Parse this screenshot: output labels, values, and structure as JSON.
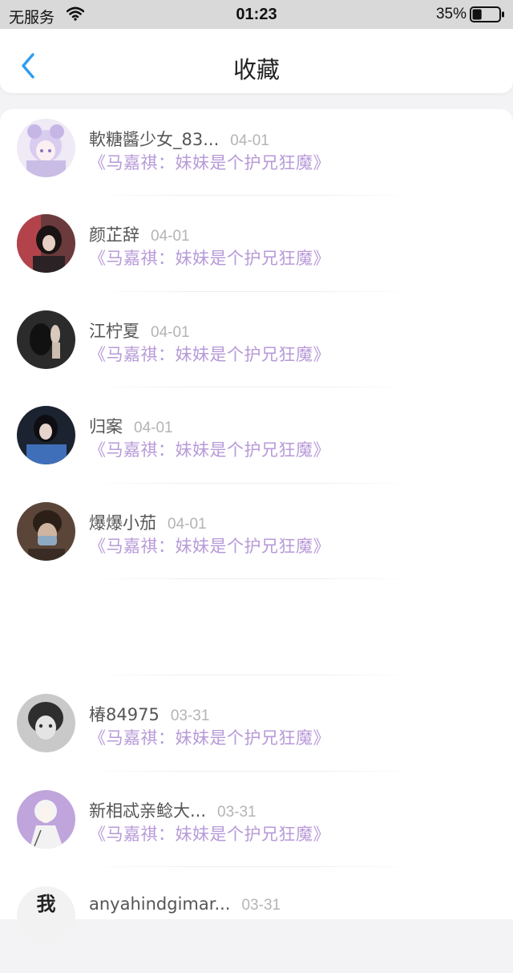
{
  "status_bar": {
    "carrier": "无服务",
    "time": "01:23",
    "battery_percent": "35%",
    "battery_level": 0.35
  },
  "header": {
    "back_icon": "chevron-left-icon",
    "title": "收藏"
  },
  "favorites": [
    {
      "name": "軟糖醬少女_83...",
      "date": "04-01",
      "title": "《马嘉祺：妹妹是个护兄狂魔》"
    },
    {
      "name": "颜芷辞",
      "date": "04-01",
      "title": "《马嘉祺：妹妹是个护兄狂魔》"
    },
    {
      "name": "江柠夏",
      "date": "04-01",
      "title": "《马嘉祺：妹妹是个护兄狂魔》"
    },
    {
      "name": "归案",
      "date": "04-01",
      "title": "《马嘉祺：妹妹是个护兄狂魔》"
    },
    {
      "name": "爆爆小茄",
      "date": "04-01",
      "title": "《马嘉祺：妹妹是个护兄狂魔》"
    },
    {
      "name": "椿84975",
      "date": "03-31",
      "title": "《马嘉祺：妹妹是个护兄狂魔》"
    },
    {
      "name": "新相忒亲鲶大...",
      "date": "03-31",
      "title": "《马嘉祺：妹妹是个护兄狂魔》"
    },
    {
      "name": "anyahindgimar...",
      "date": "03-31",
      "avatar_text": "我"
    }
  ],
  "colors": {
    "accent_blue": "#2f9cf0",
    "title_purple": "#b79ad8",
    "date_gray": "#b4b4b4"
  }
}
